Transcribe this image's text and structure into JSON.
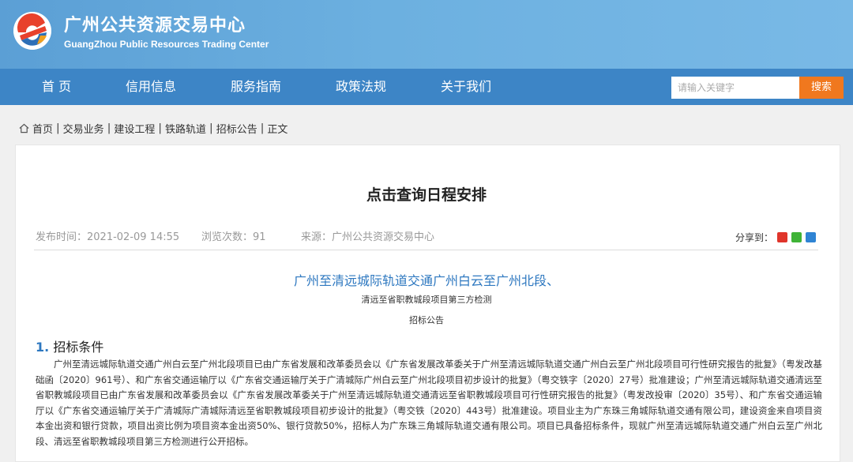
{
  "header": {
    "title": "广州公共资源交易中心",
    "subtitle": "GuangZhou Public Resources Trading Center",
    "logo_icon": "gzggzy-logo"
  },
  "nav": {
    "items": [
      "首 页",
      "信用信息",
      "服务指南",
      "政策法规",
      "关于我们"
    ]
  },
  "search": {
    "placeholder": "请输入关键字",
    "button_label": "搜索"
  },
  "breadcrumb": [
    "首页",
    "交易业务",
    "建设工程",
    "铁路轨道",
    "招标公告",
    "正文"
  ],
  "article": {
    "title": "点击查询日程安排",
    "publish_time": "发布时间：2021-02-09 14:55",
    "views": "浏览次数：91",
    "source": "来源：广州公共资源交易中心",
    "share_label": "分享到：",
    "share_icons": [
      "weibo-icon",
      "wechat-icon",
      "qq-icon"
    ],
    "subtitle_1": "广州至清远城际轨道交通广州白云至广州北段、",
    "subtitle_2": "清远至省职教城段项目第三方检测",
    "subtitle_3": "招标公告",
    "section_number": "1.",
    "section_title": "招标条件",
    "paragraph": "广州至清远城际轨道交通广州白云至广州北段项目已由广东省发展和改革委员会以《广东省发展改革委关于广州至清远城际轨道交通广州白云至广州北段项目可行性研究报告的批复》（粤发改基础函〔2020〕961号）、和广东省交通运输厅以《广东省交通运输厅关于广清城际广州白云至广州北段项目初步设计的批复》（粤交铁字〔2020〕27号）批准建设；广州至清远城际轨道交通清远至省职教城段项目已由广东省发展和改革委员会以《广东省发展改革委关于广州至清远城际轨道交通清远至省职教城段项目可行性研究报告的批复》（粤发改投审〔2020〕35号）、和广东省交通运输厅以《广东省交通运输厅关于广清城际广清城际清远至省职教城段项目初步设计的批复》（粤交铁〔2020〕443号）批准建设。项目业主为广东珠三角城际轨道交通有限公司，建设资金来自项目资本金出资和银行贷款，项目出资比例为项目资本金出资50%、银行贷款50%，招标人为广东珠三角城际轨道交通有限公司。项目已具备招标条件，现就广州至清远城际轨道交通广州白云至广州北段、清远至省职教城段项目第三方检测进行公开招标。"
  },
  "colors": {
    "header_bg": "#6aaedf",
    "nav_bg": "#3d85c6",
    "search_button": "#f0781e",
    "subtitle_blue": "#2e78c0"
  }
}
